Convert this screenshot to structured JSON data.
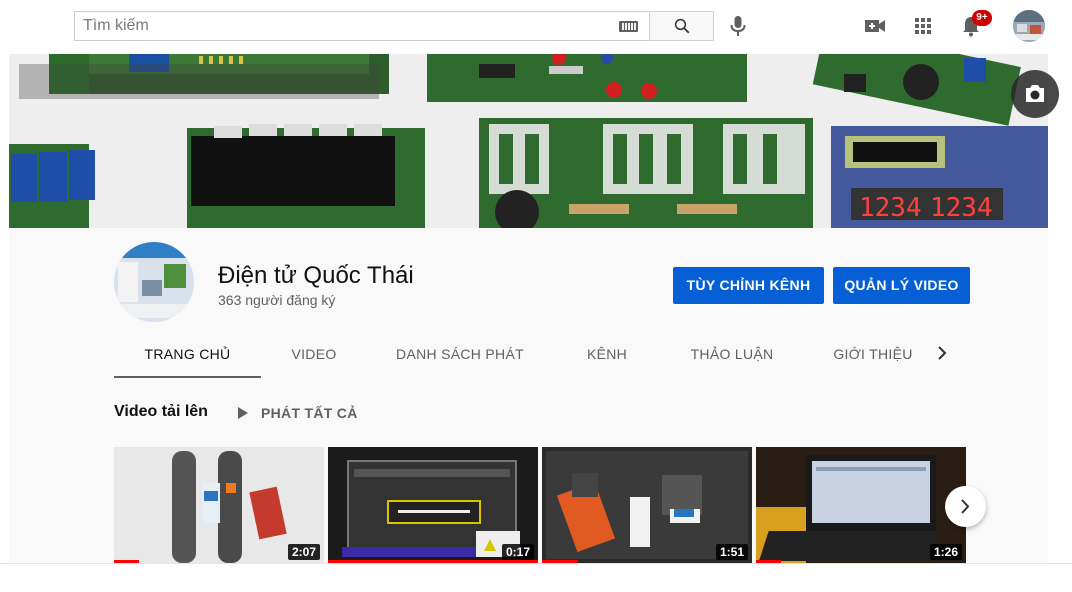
{
  "search": {
    "placeholder": "Tìm kiếm"
  },
  "header": {
    "notification_count": "9+"
  },
  "channel": {
    "name": "Điện tử Quốc Thái",
    "subscribers": "363 người đăng ký",
    "customize_label": "TÙY CHỈNH KÊNH",
    "manage_label": "QUẢN LÝ VIDEO"
  },
  "tabs": [
    {
      "label": "TRANG CHỦ",
      "active": true
    },
    {
      "label": "VIDEO"
    },
    {
      "label": "DANH SÁCH PHÁT"
    },
    {
      "label": "KÊNH"
    },
    {
      "label": "THẢO LUẬN"
    },
    {
      "label": "GIỚI THIỆU"
    }
  ],
  "uploads": {
    "title": "Video tải lên",
    "play_all_label": "PHÁT TẤT CẢ",
    "videos": [
      {
        "duration": "2:07",
        "watched_fraction": 0.12
      },
      {
        "duration": "0:17",
        "watched_fraction": 1.0
      },
      {
        "duration": "1:51",
        "watched_fraction": 0.17
      },
      {
        "duration": "1:26",
        "watched_fraction": 0.12
      }
    ]
  },
  "banner": {
    "display_texts": [
      "1234",
      "1234"
    ]
  },
  "icons": {
    "keyboard": "keyboard-icon",
    "search": "search-icon",
    "mic": "mic-icon",
    "create": "create-video-icon",
    "apps": "apps-icon",
    "notifications": "bell-icon",
    "camera": "camera-icon",
    "play": "play-icon",
    "chevron": "chevron-right-icon"
  },
  "colors": {
    "primary_button": "#065fd4",
    "notification_badge": "#cc0000",
    "progress": "#ff0000"
  }
}
